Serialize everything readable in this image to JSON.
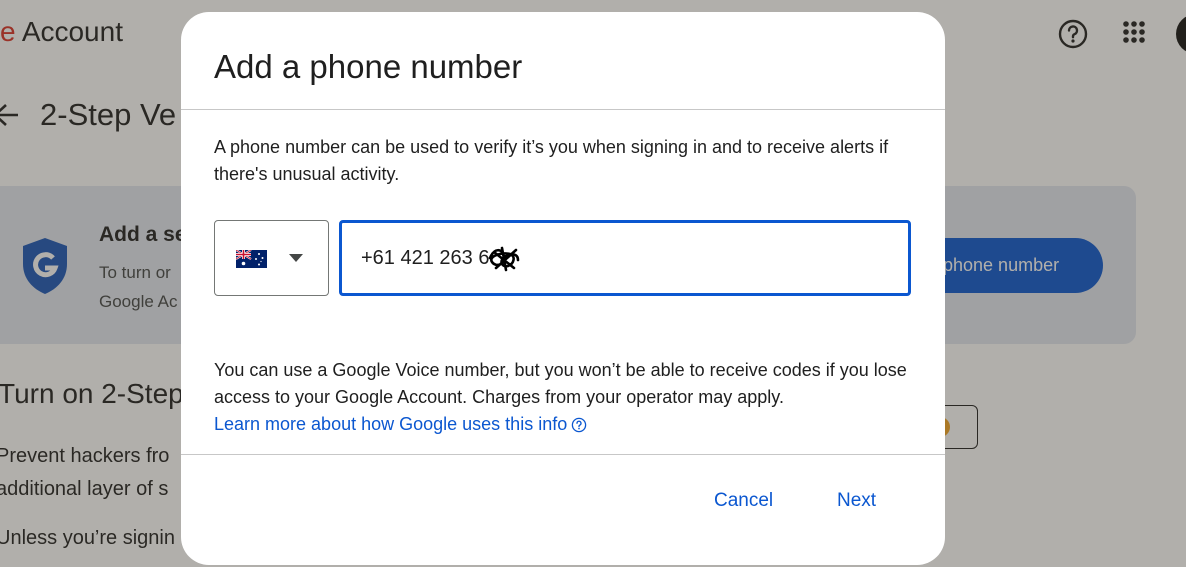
{
  "background": {
    "brand_suffix": "Account",
    "page_title": "2-Step Ve",
    "card": {
      "title": "Add a se",
      "text": "To turn or\nGoogle Ac",
      "button_label": "phone number"
    },
    "section": {
      "title": "Turn on 2-Step",
      "text": "Prevent hackers fro\nadditional layer of s",
      "text2": "Unless you’re signin"
    }
  },
  "dialog": {
    "title": "Add a phone number",
    "description": "A phone number can be used to verify it’s you when signing in and to receive alerts if there's unusual activity.",
    "country": "Australia",
    "phone_value": "+61 421 263 6",
    "note": "You can use a Google Voice number, but you won’t be able to receive codes if you lose access to your Google Account. Charges from your operator may apply.",
    "learn_more": "Learn more about how Google uses this info",
    "cancel_label": "Cancel",
    "next_label": "Next"
  },
  "colors": {
    "accent": "#0b57d0",
    "brand_red": "#d93025",
    "flag_blue": "#012169",
    "flag_red": "#c8102e"
  },
  "icons": [
    "help-icon",
    "apps-icon",
    "back-icon",
    "shield-icon",
    "flag-icon",
    "caret-down-icon",
    "info-icon"
  ]
}
